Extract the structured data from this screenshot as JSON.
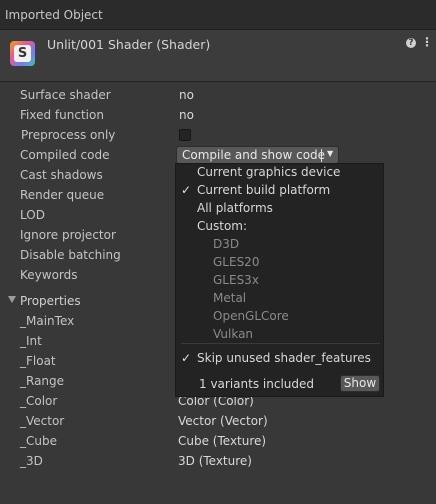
{
  "window": {
    "title": "Imported Object"
  },
  "header": {
    "object_title": "Unlit/001 Shader (Shader)",
    "icon": "shader-icon",
    "icon_letter": "S"
  },
  "info_rows": [
    {
      "label": "Surface shader",
      "value": "no"
    },
    {
      "label": "Fixed function",
      "value": "no"
    },
    {
      "label": "Preprocess only",
      "checked": false
    },
    {
      "label": "Compiled code",
      "button": "Compile and show code"
    },
    {
      "label": "Cast shadows"
    },
    {
      "label": "Render queue"
    },
    {
      "label": "LOD"
    },
    {
      "label": "Ignore projector"
    },
    {
      "label": "Disable batching"
    },
    {
      "label": "Keywords"
    }
  ],
  "properties": {
    "label": "Properties",
    "items": [
      {
        "name": "_MainTex",
        "type": ""
      },
      {
        "name": "_Int",
        "type": ""
      },
      {
        "name": "_Float",
        "type": ""
      },
      {
        "name": "_Range",
        "type": ""
      },
      {
        "name": "_Color",
        "type": "Color (Color)"
      },
      {
        "name": "_Vector",
        "type": "Vector (Vector)"
      },
      {
        "name": "_Cube",
        "type": "Cube (Texture)"
      },
      {
        "name": "_3D",
        "type": "3D (Texture)"
      }
    ]
  },
  "dropdown": {
    "items": [
      {
        "label": "Current graphics device",
        "checked": false,
        "enabled": true
      },
      {
        "label": "Current build platform",
        "checked": true,
        "enabled": true
      },
      {
        "label": "All platforms",
        "checked": false,
        "enabled": true
      },
      {
        "label": "Custom:",
        "checked": false,
        "enabled": true
      }
    ],
    "custom_platforms": [
      "D3D",
      "GLES20",
      "GLES3x",
      "Metal",
      "OpenGLCore",
      "Vulkan"
    ],
    "skip_unused": {
      "label": "Skip unused shader_features",
      "checked": true
    },
    "variants_text": "1 variants included",
    "show_button": "Show"
  },
  "colors": {
    "background": "#383838",
    "dropdown_bg": "#232323",
    "text": "#c4c4c4",
    "disabled_text": "#8a8a8a"
  }
}
